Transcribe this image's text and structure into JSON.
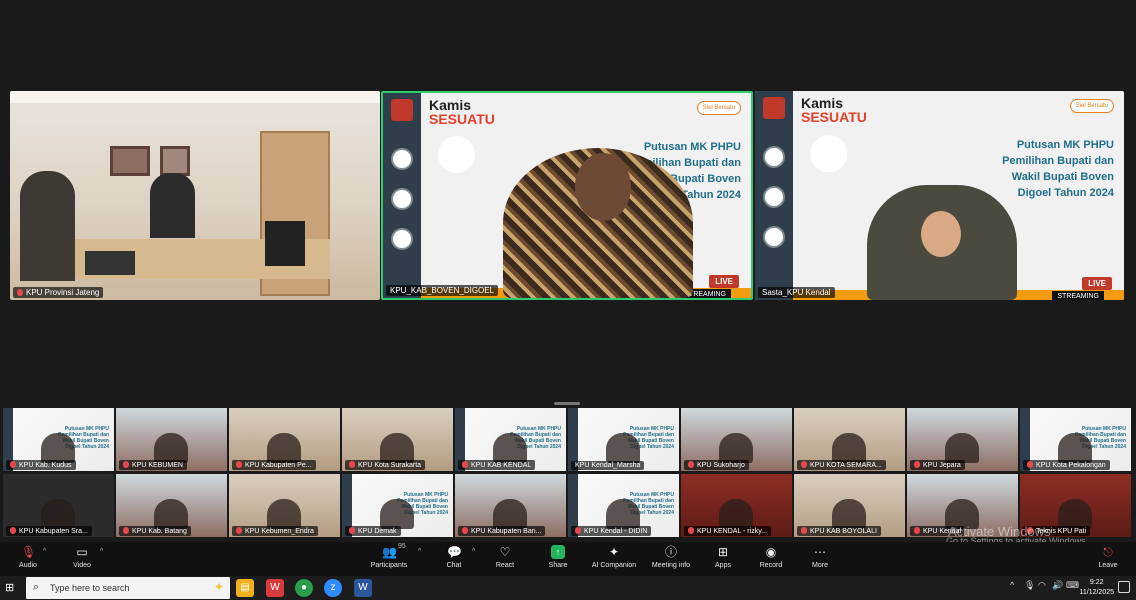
{
  "main_tiles": [
    {
      "name": "KPU Provinsi Jateng",
      "muted": true
    },
    {
      "name": "KPU_KAB_BOVEN_DIGOEL",
      "muted": false
    },
    {
      "name": "Sasta_KPU Kendal",
      "muted": false
    }
  ],
  "slide": {
    "brand_line1": "Kamis",
    "brand_line2": "SESUATU",
    "badge": "Siel Bersatu",
    "title": "Putusan MK PHPU Pemilihan Bupati dan Wakil Bupati Boven Digoel Tahun 2024",
    "live": "LIVE",
    "streaming": "STREAMING"
  },
  "gallery_row1": [
    {
      "name": "KPU Kab. Kudus",
      "muted": true,
      "kind": "slide"
    },
    {
      "name": "KPU KEBUMEN",
      "muted": true,
      "kind": "office"
    },
    {
      "name": "KPU Kabupaten Pe...",
      "muted": true,
      "kind": "room"
    },
    {
      "name": "KPU Kota Surakarta",
      "muted": true,
      "kind": "room"
    },
    {
      "name": "KPU KAB KENDAL",
      "muted": true,
      "kind": "slide"
    },
    {
      "name": "KPU Kendal_Marsha",
      "muted": false,
      "kind": "slide"
    },
    {
      "name": "KPU Sukoharjo",
      "muted": true,
      "kind": "office"
    },
    {
      "name": "KPU KOTA SEMARA...",
      "muted": true,
      "kind": "room"
    },
    {
      "name": "KPU Jepara",
      "muted": true,
      "kind": "office"
    },
    {
      "name": "KPU Kota Pekalongan",
      "muted": true,
      "kind": "slide"
    }
  ],
  "gallery_row2": [
    {
      "name": "KPU Kabupaten Sra...",
      "muted": true,
      "kind": "dark"
    },
    {
      "name": "KPU Kab. Batang",
      "muted": true,
      "kind": "office"
    },
    {
      "name": "KPU Kebumen_Endra",
      "muted": true,
      "kind": "room"
    },
    {
      "name": "KPU Demak",
      "muted": true,
      "kind": "slide"
    },
    {
      "name": "KPU Kabupaten Ban...",
      "muted": true,
      "kind": "office"
    },
    {
      "name": "KPU Kendal - DIDIN",
      "muted": true,
      "kind": "slide"
    },
    {
      "name": "KPU KENDAL - rizky...",
      "muted": true,
      "kind": "banner"
    },
    {
      "name": "KPU KAB BOYOLALI",
      "muted": true,
      "kind": "room"
    },
    {
      "name": "KPU Kendal",
      "muted": true,
      "kind": "office"
    },
    {
      "name": "Teknis KPU Pati",
      "muted": true,
      "kind": "banner"
    }
  ],
  "watermark": {
    "line1": "Activate Windows",
    "line2": "Go to Settings to activate Windows."
  },
  "toolbar": {
    "audio": "Audio",
    "video": "Video",
    "participants": "Participants",
    "participants_count": "95",
    "chat": "Chat",
    "react": "React",
    "share": "Share",
    "ai_companion": "AI Companion",
    "meeting_info": "Meeting info",
    "apps": "Apps",
    "record": "Record",
    "more": "More",
    "leave": "Leave"
  },
  "taskbar": {
    "search_placeholder": "Type here to search",
    "time": "9:22",
    "date": "11/12/2025"
  }
}
